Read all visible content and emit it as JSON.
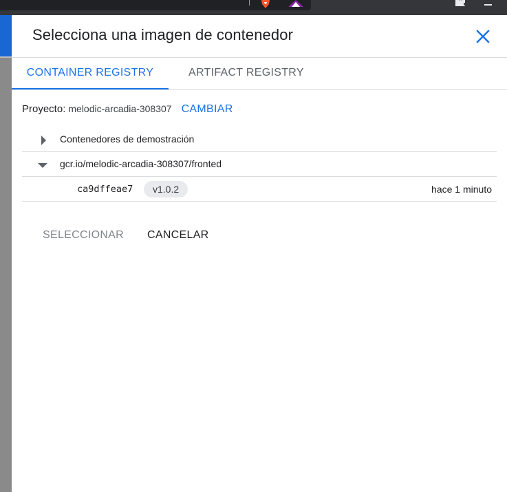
{
  "dialog": {
    "title": "Selecciona una imagen de contenedor"
  },
  "tabs": [
    {
      "label": "CONTAINER REGISTRY",
      "active": true
    },
    {
      "label": "ARTIFACT REGISTRY",
      "active": false
    }
  ],
  "project": {
    "label": "Proyecto:",
    "id": "melodic-arcadia-308307",
    "change_label": "CAMBIAR"
  },
  "tree": {
    "demo_folder": "Contenedores de demostración",
    "repository": "gcr.io/melodic-arcadia-308307/fronted",
    "image": {
      "digest": "ca9dffeae7",
      "tag": "v1.0.2",
      "time": "hace 1 minuto"
    }
  },
  "actions": {
    "select_label": "SELECCIONAR",
    "cancel_label": "CANCELAR"
  },
  "colors": {
    "accent": "#1a73e8",
    "text": "#202124",
    "muted": "#5f6368",
    "disabled": "#80868b",
    "divider": "#dadce0"
  },
  "icons": [
    "close-icon",
    "expand-arrow-icon",
    "collapse-arrow-icon",
    "brave-icon",
    "warning-triangle-icon",
    "puzzle-icon",
    "minimize-icon"
  ]
}
